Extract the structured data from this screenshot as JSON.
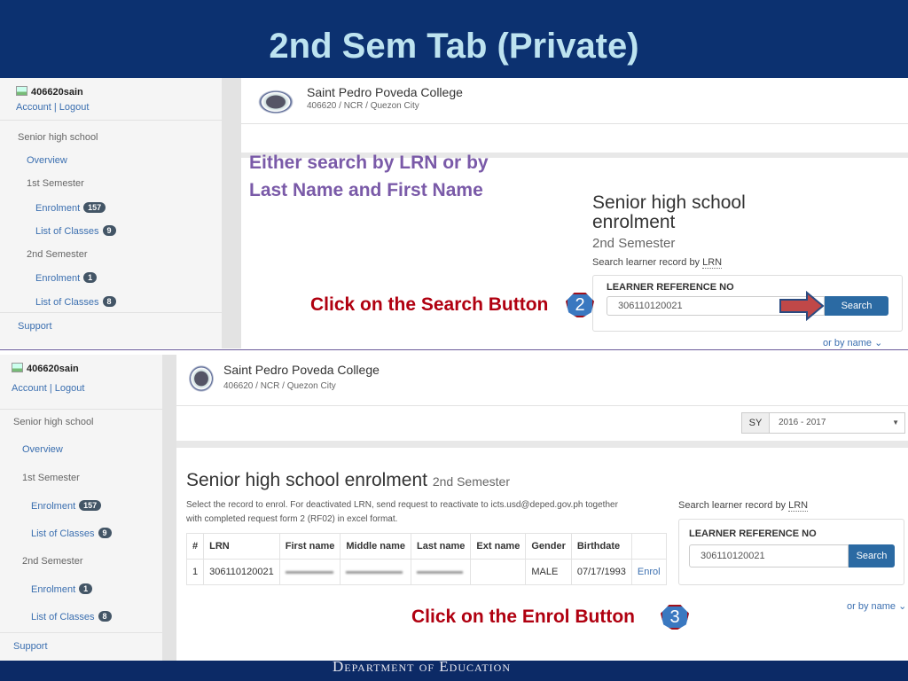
{
  "slide": {
    "title": "2nd Sem Tab (Private)",
    "footer": "Department of Education"
  },
  "colors": {
    "header": "#0c3170",
    "title": "#bde3f0",
    "link": "#3b6fb0",
    "button": "#2b6aa3",
    "annotation_red": "#b00010",
    "annotation_purple": "#7a5aa8"
  },
  "sidebar": {
    "user": "406620sain",
    "account": "Account",
    "sep": "|",
    "logout": "Logout",
    "section": "Senior high school",
    "overview": "Overview",
    "sem1": "1st Semester",
    "sem1_enrol": "Enrolment",
    "sem1_enrol_count": "157",
    "sem1_classes": "List of Classes",
    "sem1_classes_count": "9",
    "sem2": "2nd Semester",
    "sem2_enrol": "Enrolment",
    "sem2_enrol_count": "1",
    "sem2_classes": "List of Classes",
    "sem2_classes_count": "8",
    "support": "Support"
  },
  "school": {
    "name": "Saint Pedro Poveda College",
    "location": "406620 / NCR / Quezon City"
  },
  "top": {
    "annotation_search": "Either search by LRN or by",
    "annotation_search2": "Last Name and First Name",
    "page_title": "Senior high school enrolment",
    "subtitle": "2nd Semester",
    "search_label": "Search learner record by",
    "lrn_abbr": "LRN",
    "field_label": "LEARNER REFERENCE NO",
    "lrn_value": "306110120021",
    "search_button": "Search",
    "by_name": "or by name",
    "annotation_click": "Click on the Search Button",
    "step": "2"
  },
  "bottom": {
    "sy_label": "SY",
    "sy_value": "2016 - 2017",
    "page_title": "Senior high school enrolment",
    "subtitle": "2nd Semester",
    "instructions1": "Select the record to enrol. For deactivated LRN, send request to reactivate to icts.usd@deped.gov.ph together",
    "instructions2": "with completed request form 2 (RF02) in excel format.",
    "table": {
      "headers": [
        "#",
        "LRN",
        "First name",
        "Middle name",
        "Last name",
        "Ext name",
        "Gender",
        "Birthdate",
        ""
      ],
      "rows": [
        {
          "num": "1",
          "lrn": "306110120021",
          "ext": "",
          "gender": "MALE",
          "birthdate": "07/17/1993",
          "action": "Enrol"
        }
      ]
    },
    "search_label": "Search learner record by",
    "lrn_abbr": "LRN",
    "field_label": "LEARNER REFERENCE NO",
    "lrn_value": "306110120021",
    "search_button": "Search",
    "by_name": "or by name",
    "annotation_click": "Click on the Enrol Button",
    "step": "3"
  }
}
